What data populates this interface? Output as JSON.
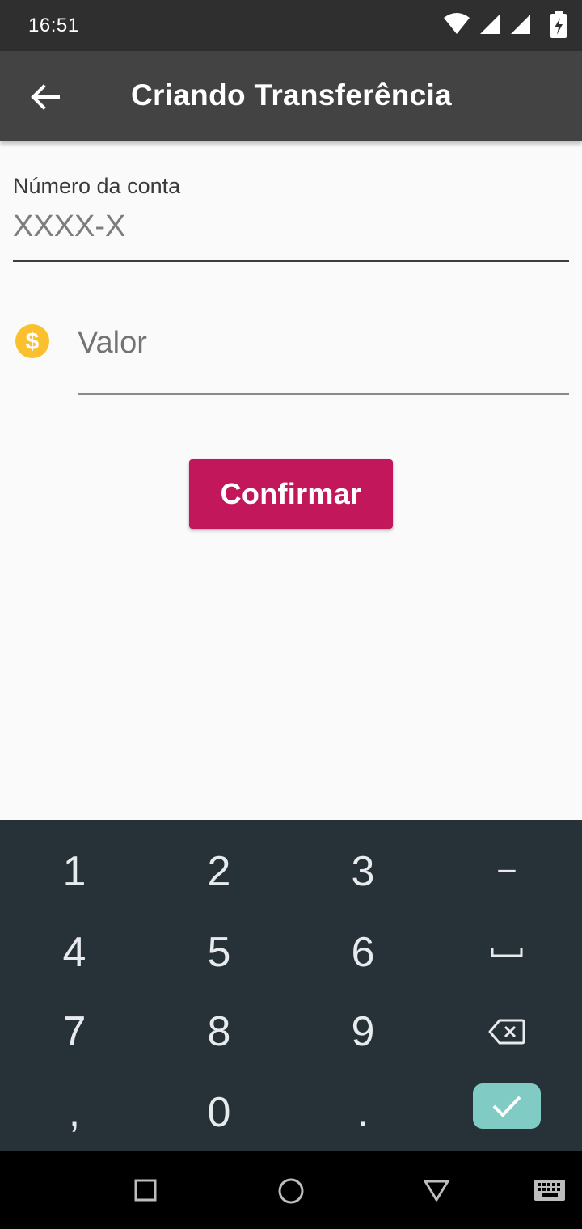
{
  "status_bar": {
    "time": "16:51"
  },
  "app_bar": {
    "title": "Criando Transferência",
    "back_icon": "arrow-left-icon"
  },
  "account_field": {
    "label": "Número da conta",
    "placeholder": "XXXX-X",
    "value": ""
  },
  "value_field": {
    "placeholder": "Valor",
    "value": "",
    "icon": "monetization-icon",
    "icon_color": "#fbc02d"
  },
  "confirm_button": {
    "label": "Confirmar",
    "color": "#c2185b"
  },
  "keyboard": {
    "keys": [
      "1",
      "2",
      "3",
      "−",
      "4",
      "5",
      "6",
      "␣",
      "7",
      "8",
      "9",
      "⌫",
      ",",
      "0",
      ".",
      "✓"
    ],
    "key_1": "1",
    "key_2": "2",
    "key_3": "3",
    "key_minus": "−",
    "key_4": "4",
    "key_5": "5",
    "key_6": "6",
    "key_7": "7",
    "key_8": "8",
    "key_9": "9",
    "key_comma": ",",
    "key_0": "0",
    "key_period": ".",
    "enter_color": "#80cbc4"
  },
  "colors": {
    "app_bar": "#434343",
    "status_bar": "#2f2f2f",
    "keyboard": "#263238",
    "accent": "#c2185b"
  }
}
